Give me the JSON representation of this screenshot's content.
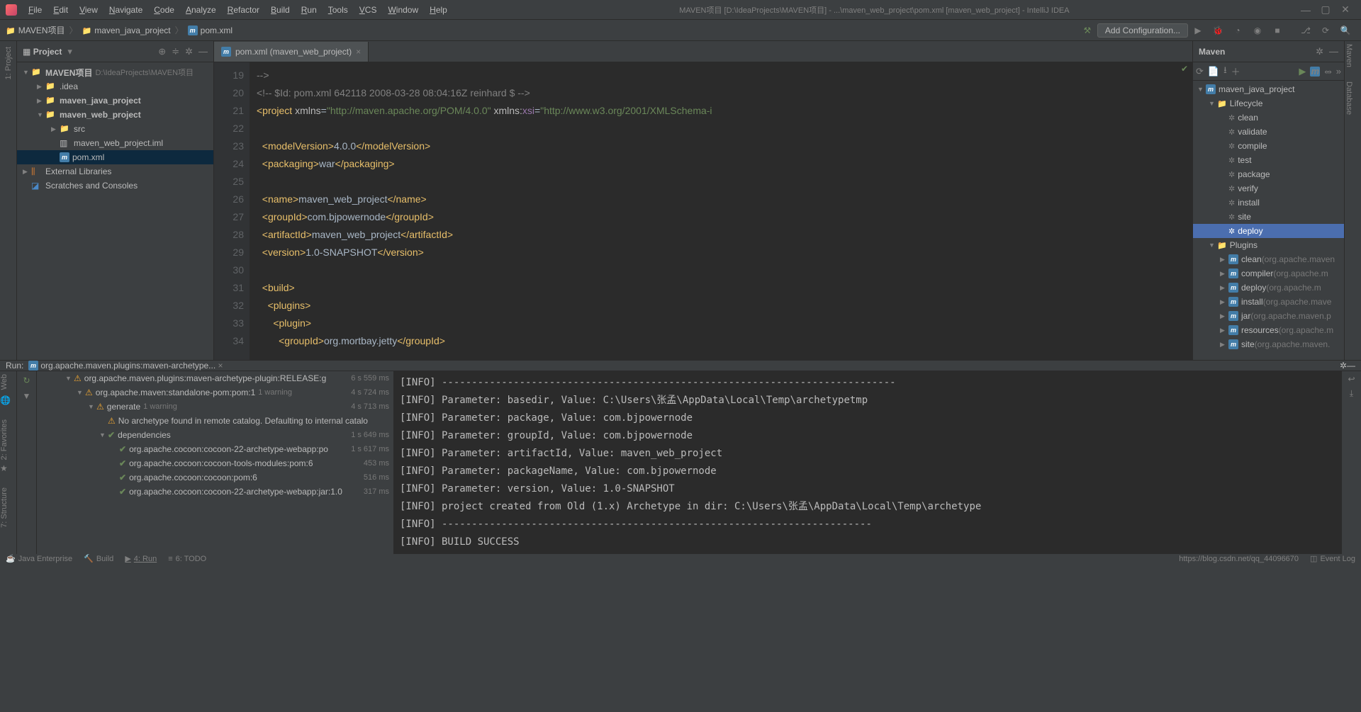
{
  "menu": [
    "File",
    "Edit",
    "View",
    "Navigate",
    "Code",
    "Analyze",
    "Refactor",
    "Build",
    "Run",
    "Tools",
    "VCS",
    "Window",
    "Help"
  ],
  "windowTitle": "MAVEN项目 [D:\\IdeaProjects\\MAVEN项目] - ...\\maven_web_project\\pom.xml [maven_web_project] - IntelliJ IDEA",
  "breadcrumb": {
    "root": "MAVEN项目",
    "mod": "maven_java_project",
    "file": "pom.xml"
  },
  "toolbar": {
    "config": "Add Configuration..."
  },
  "projectPanel": {
    "title": "Project"
  },
  "tree": {
    "root": "MAVEN项目",
    "rootPath": "D:\\IdeaProjects\\MAVEN项目",
    "idea": ".idea",
    "mod1": "maven_java_project",
    "mod2": "maven_web_project",
    "src": "src",
    "iml": "maven_web_project.iml",
    "pom": "pom.xml",
    "ext": "External Libraries",
    "scr": "Scratches and Consoles"
  },
  "tab": {
    "label": "pom.xml (maven_web_project)"
  },
  "lineStart": 19,
  "lineEnd": 34,
  "maven": {
    "title": "Maven",
    "project": "maven_java_project",
    "lifecycleLabel": "Lifecycle",
    "lifecycle": [
      "clean",
      "validate",
      "compile",
      "test",
      "package",
      "verify",
      "install",
      "site",
      "deploy"
    ],
    "selected": "deploy",
    "pluginsLabel": "Plugins",
    "plugins": [
      {
        "n": "clean",
        "s": "(org.apache.maven"
      },
      {
        "n": "compiler",
        "s": "(org.apache.m"
      },
      {
        "n": "deploy",
        "s": "(org.apache.m"
      },
      {
        "n": "install",
        "s": "(org.apache.mave"
      },
      {
        "n": "jar",
        "s": "(org.apache.maven.p"
      },
      {
        "n": "resources",
        "s": "(org.apache.m"
      },
      {
        "n": "site",
        "s": "(org.apache.maven."
      }
    ]
  },
  "run": {
    "label": "Run:",
    "title": "org.apache.maven.plugins:maven-archetype...",
    "tree": [
      {
        "ind": 0,
        "arr": "▼",
        "ic": "warn",
        "t": "org.apache.maven.plugins:maven-archetype-plugin:RELEASE:g",
        "tm": "6 s 559 ms"
      },
      {
        "ind": 1,
        "arr": "▼",
        "ic": "warn",
        "t": "org.apache.maven:standalone-pom:pom:1",
        "cnt": "1 warning",
        "tm": "4 s 724 ms"
      },
      {
        "ind": 2,
        "arr": "▼",
        "ic": "warn",
        "t": "generate",
        "cnt": "1 warning",
        "tm": "4 s 713 ms"
      },
      {
        "ind": 3,
        "arr": "",
        "ic": "warn",
        "t": "No archetype found in remote catalog. Defaulting to internal catalo",
        "tm": ""
      },
      {
        "ind": 3,
        "arr": "▼",
        "ic": "ok",
        "t": "dependencies",
        "tm": "1 s 649 ms"
      },
      {
        "ind": 4,
        "arr": "",
        "ic": "ok",
        "t": "org.apache.cocoon:cocoon-22-archetype-webapp:po",
        "tm": "1 s 617 ms"
      },
      {
        "ind": 4,
        "arr": "",
        "ic": "ok",
        "t": "org.apache.cocoon:cocoon-tools-modules:pom:6",
        "tm": "453 ms"
      },
      {
        "ind": 4,
        "arr": "",
        "ic": "ok",
        "t": "org.apache.cocoon:cocoon:pom:6",
        "tm": "516 ms"
      },
      {
        "ind": 4,
        "arr": "",
        "ic": "ok",
        "t": "org.apache.cocoon:cocoon-22-archetype-webapp:jar:1.0",
        "tm": "317 ms"
      }
    ]
  },
  "console": [
    "[INFO] ----------------------------------------------------------------------------",
    "[INFO] Parameter: basedir, Value: C:\\Users\\张孟\\AppData\\Local\\Temp\\archetypetmp",
    "[INFO] Parameter: package, Value: com.bjpowernode",
    "[INFO] Parameter: groupId, Value: com.bjpowernode",
    "[INFO] Parameter: artifactId, Value: maven_web_project",
    "[INFO] Parameter: packageName, Value: com.bjpowernode",
    "[INFO] Parameter: version, Value: 1.0-SNAPSHOT",
    "[INFO] project created from Old (1.x) Archetype in dir: C:\\Users\\张孟\\AppData\\Local\\Temp\\archetype",
    "[INFO] ------------------------------------------------------------------------",
    "[INFO] BUILD SUCCESS"
  ],
  "status": {
    "je": "Java Enterprise",
    "build": "Build",
    "run": "4: Run",
    "todo": "6: TODO",
    "url": "https://blog.csdn.net/qq_44096670",
    "evt": "Event Log"
  },
  "sidebarRight": {
    "maven": "Maven",
    "db": "Database"
  },
  "sidebarLeft": {
    "proj": "1: Project",
    "web": "Web",
    "fav": "2: Favorites",
    "struct": "7: Structure"
  }
}
